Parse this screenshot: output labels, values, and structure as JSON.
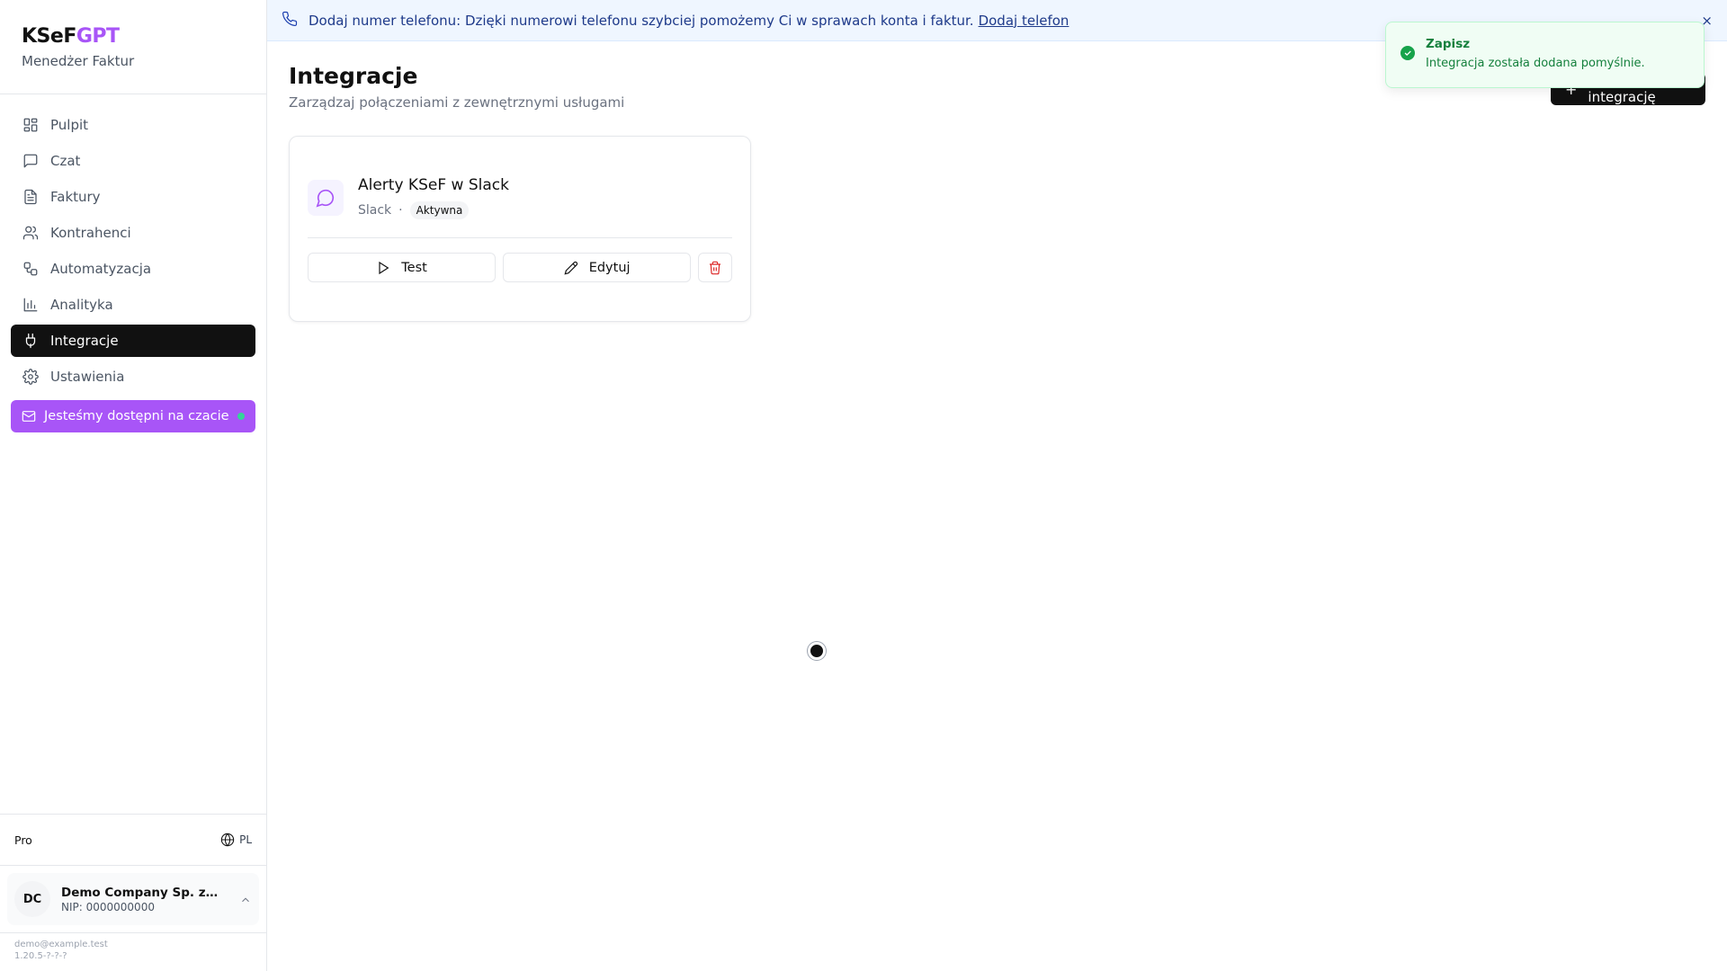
{
  "brand": {
    "name_main": "KSeF",
    "name_accent": "GPT",
    "subtitle": "Menedżer Faktur"
  },
  "sidebar": {
    "items": [
      {
        "label": "Pulpit",
        "icon": "dashboard-icon"
      },
      {
        "label": "Czat",
        "icon": "chat-icon"
      },
      {
        "label": "Faktury",
        "icon": "file-icon"
      },
      {
        "label": "Kontrahenci",
        "icon": "users-icon"
      },
      {
        "label": "Automatyzacja",
        "icon": "workflow-icon"
      },
      {
        "label": "Analityka",
        "icon": "chart-icon"
      },
      {
        "label": "Integracje",
        "icon": "plug-icon",
        "active": true
      },
      {
        "label": "Ustawienia",
        "icon": "gear-icon"
      }
    ],
    "chat_cta": "Jesteśmy dostępni na czacie",
    "plan": "Pro",
    "language": "PL",
    "company": {
      "initials": "DC",
      "name": "Demo Company Sp. z o.o.",
      "nip": "NIP: 0000000000"
    },
    "email": "demo@example.test",
    "version": "1.20.5-?-?-?"
  },
  "banner": {
    "text": "Dodaj numer telefonu: Dzięki numerowi telefonu szybciej pomożemy Ci w sprawach konta i faktur.",
    "link": "Dodaj telefon",
    "close": "×"
  },
  "page": {
    "title": "Integracje",
    "subtitle": "Zarządzaj połączeniami z zewnętrznymi usługami",
    "add_button": "Dodaj integrację"
  },
  "integration": {
    "title": "Alerty KSeF w Slack",
    "service": "Slack",
    "separator": "·",
    "status": "Aktywna",
    "test_label": "Test",
    "edit_label": "Edytuj"
  },
  "toast": {
    "title": "Zapisz",
    "message": "Integracja została dodana pomyślnie."
  },
  "colors": {
    "accent": "#a855f7",
    "active_nav": "#111111",
    "success": "#16a34a",
    "danger": "#dc2626"
  }
}
